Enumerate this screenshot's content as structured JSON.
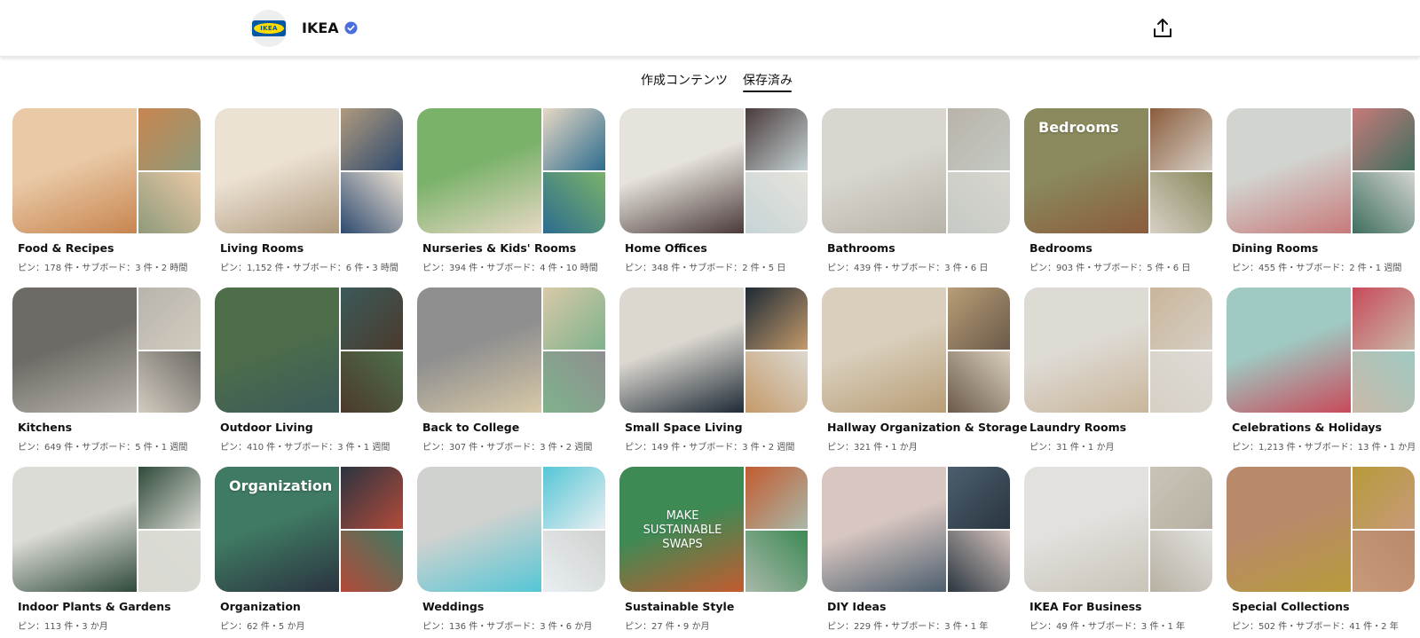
{
  "profile": {
    "logo_text": "IKEA",
    "name": "IKEA",
    "verified_icon": "verified-badge-icon",
    "share_icon": "share-upload-icon"
  },
  "tabs": [
    {
      "label": "作成コンテンツ",
      "active": false
    },
    {
      "label": "保存済み",
      "active": true
    }
  ],
  "colors": {
    "ikea_blue": "#0058a3",
    "ikea_yellow": "#ffdb00",
    "verified": "#4a6ee0"
  },
  "boards": [
    {
      "title": "Food & Recipes",
      "meta": "ピン：178 件・サブボード：3 件・2 時間",
      "palette": [
        "#e9c9a6",
        "#c8854f",
        "#8f9a7b"
      ]
    },
    {
      "title": "Living Rooms",
      "meta": "ピン：1,152 件・サブボード：6 件・3 時間",
      "palette": [
        "#ece2d4",
        "#b09a7e",
        "#2e4a6e"
      ]
    },
    {
      "title": "Nurseries & Kids' Rooms",
      "meta": "ピン：394 件・サブボード：4 件・10 時間",
      "palette": [
        "#7ab26a",
        "#e7d8c4",
        "#2c6c8f"
      ]
    },
    {
      "title": "Home Offices",
      "meta": "ピン：348 件・サブボード：2 件・5 日",
      "palette": [
        "#e6e3dc",
        "#4a3a3a",
        "#c6d4d6"
      ]
    },
    {
      "title": "Bathrooms",
      "meta": "ピン：439 件・サブボード：3 件・6 日",
      "palette": [
        "#d8d6cf",
        "#b9b3a8",
        "#c5c9c4"
      ]
    },
    {
      "title": "Bedrooms",
      "meta": "ピン：903 件・サブボード：5 件・6 日",
      "palette": [
        "#8a8a5e",
        "#8b5c3c",
        "#d6d0c6"
      ],
      "cover_text": "Bedrooms"
    },
    {
      "title": "Dining Rooms",
      "meta": "ピン：455 件・サブボード：2 件・1 週間",
      "palette": [
        "#d2d4d0",
        "#c77a7a",
        "#3f6f5e"
      ]
    },
    {
      "title": "Kitchens",
      "meta": "ピン：649 件・サブボード：5 件・1 週間",
      "palette": [
        "#6e6b66",
        "#b8b4ac",
        "#d2cbbf"
      ]
    },
    {
      "title": "Outdoor Living",
      "meta": "ピン：410 件・サブボード：3 件・1 週間",
      "palette": [
        "#4e6e4a",
        "#3c5a5a",
        "#4b3a2c"
      ]
    },
    {
      "title": "Back to College",
      "meta": "ピン：307 件・サブボード：3 件・2 週間",
      "palette": [
        "#8f8f8f",
        "#d8c9a8",
        "#7fb28c"
      ]
    },
    {
      "title": "Small Space Living",
      "meta": "ピン：149 件・サブボード：3 件・2 週間",
      "palette": [
        "#dcd8d0",
        "#1e2a36",
        "#c49a6a"
      ]
    },
    {
      "title": "Hallway Organization & Storage",
      "meta": "ピン：321 件・1 か月",
      "palette": [
        "#d9cfbc",
        "#b89d76",
        "#6b5a4a"
      ]
    },
    {
      "title": "Laundry Rooms",
      "meta": "ピン：31 件・1 か月",
      "palette": [
        "#dedbd5",
        "#c9b59a",
        "#d6cfc4"
      ]
    },
    {
      "title": "Celebrations & Holidays",
      "meta": "ピン：1,213 件・サブボード：13 件・1 か月",
      "palette": [
        "#9fc9c2",
        "#c84a5a",
        "#c9b9a8"
      ]
    },
    {
      "title": "Indoor Plants & Gardens",
      "meta": "ピン：113 件・3 か月",
      "palette": [
        "#dcdcd6",
        "#2f4a3a",
        "#d9d9d2"
      ]
    },
    {
      "title": "Organization",
      "meta": "ピン：62 件・5 か月",
      "palette": [
        "#3f7a63",
        "#2b3440",
        "#b34a3a"
      ],
      "cover_text": "Organization"
    },
    {
      "title": "Weddings",
      "meta": "ピン：136 件・サブボード：3 件・6 か月",
      "palette": [
        "#cfd2cf",
        "#55c6d6",
        "#e9eef2"
      ]
    },
    {
      "title": "Sustainable Style",
      "meta": "ピン：27 件・9 か月",
      "palette": [
        "#3d8a55",
        "#c35b2f",
        "#a9b8a9"
      ],
      "cover_text": "MAKE SUSTAINABLE SWAPS"
    },
    {
      "title": "DIY Ideas",
      "meta": "ピン：229 件・サブボード：3 件・1 年",
      "palette": [
        "#d8c6c0",
        "#4c5e6e",
        "#2a3640"
      ]
    },
    {
      "title": "IKEA For Business",
      "meta": "ピン：49 件・サブボード：3 件・1 年",
      "palette": [
        "#e2e1de",
        "#c9c4b8",
        "#b7b0a2"
      ]
    },
    {
      "title": "Special Collections",
      "meta": "ピン：502 件・サブボード：41 件・2 年",
      "palette": [
        "#b98a6a",
        "#b89a3a",
        "#c79a7a"
      ]
    }
  ]
}
